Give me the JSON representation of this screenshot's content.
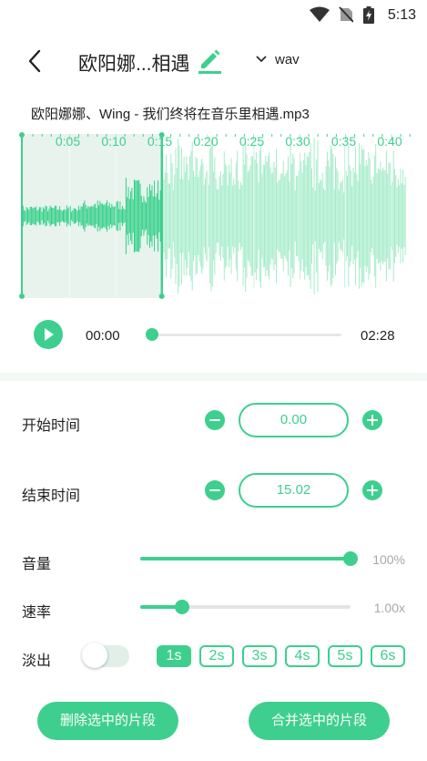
{
  "status_bar": {
    "time": "5:13",
    "icons": [
      "wifi-icon",
      "no-sim-icon",
      "battery-charging-icon"
    ]
  },
  "header": {
    "title": "欧阳娜...相遇",
    "format": "wav",
    "icons": [
      "back-arrow-icon",
      "pencil-icon",
      "chevron-down-icon"
    ]
  },
  "file": {
    "name": "欧阳娜娜、Wing - 我们终将在音乐里相遇.mp3"
  },
  "waveform": {
    "time_marks": [
      "0:05",
      "0:10",
      "0:15",
      "0:20",
      "0:25",
      "0:30",
      "0:35",
      "0:40"
    ],
    "selection_end_seconds": 15.02,
    "colors": {
      "selected": "#2fcf86",
      "unselected": "#a6ecca",
      "selection_bg": "#e8f3ee",
      "handle": "#3ecf8e"
    }
  },
  "player": {
    "current_time": "00:00",
    "total_time": "02:28",
    "progress": 0.0,
    "icons": [
      "play-icon"
    ]
  },
  "trim": {
    "start_label": "开始时间",
    "start_value": "0.00",
    "end_label": "结束时间",
    "end_value": "15.02",
    "icons": [
      "minus-icon",
      "plus-icon"
    ]
  },
  "volume": {
    "label": "音量",
    "value_text": "100%",
    "level": 1.0
  },
  "speed": {
    "label": "速率",
    "value_text": "1.00x",
    "level": 0.2
  },
  "fade": {
    "label": "淡出",
    "enabled": false,
    "options": [
      "1s",
      "2s",
      "3s",
      "4s",
      "5s",
      "6s"
    ],
    "selected_index": 0
  },
  "actions": {
    "delete_label": "删除选中的片段",
    "merge_label": "合并选中的片段"
  },
  "accent_color": "#3ecf8e"
}
